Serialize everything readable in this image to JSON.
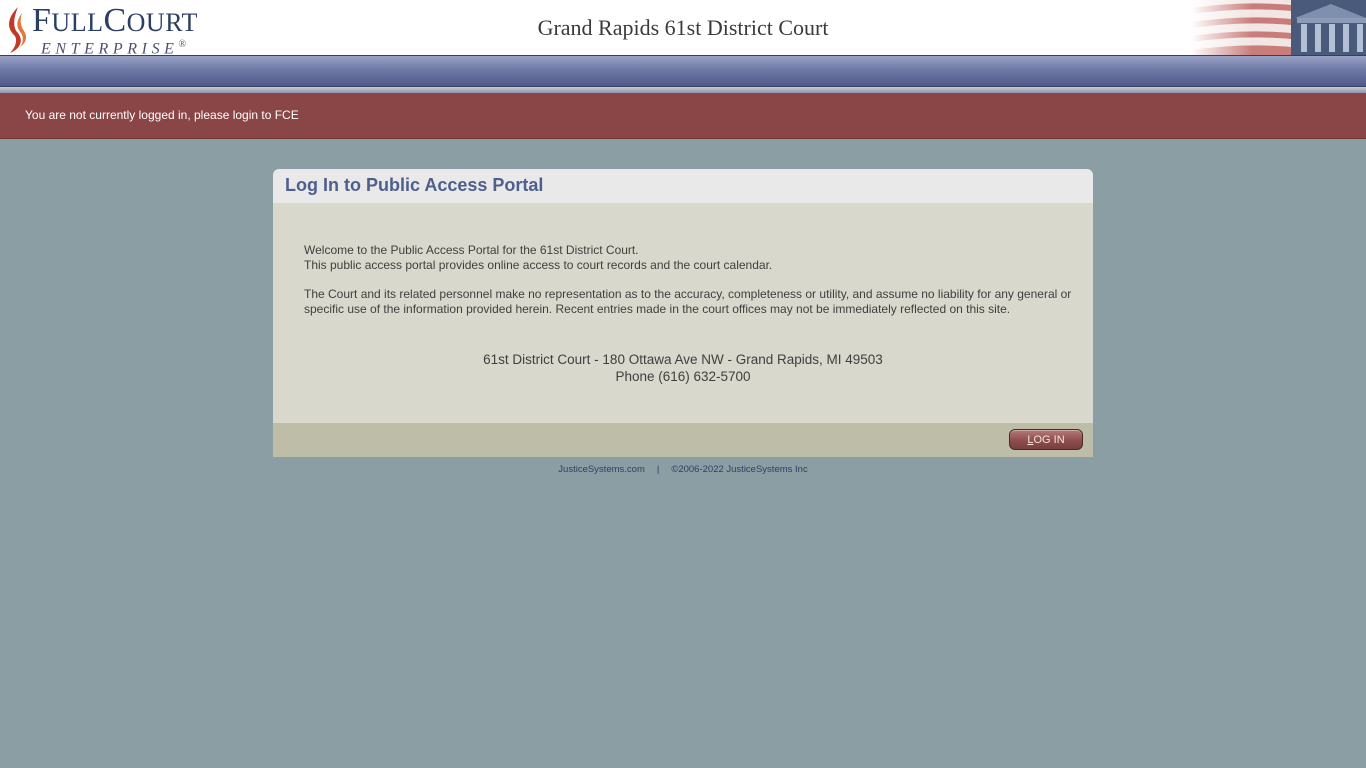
{
  "header": {
    "logo_full": "Full",
    "logo_court": "Court",
    "logo_enterprise": "ENTERPRISE",
    "logo_reg": "®",
    "court_title": "Grand Rapids 61st District Court"
  },
  "status": {
    "message": "You are not currently logged in, please login to FCE"
  },
  "panel": {
    "title": "Log In to Public Access Portal",
    "intro_line1": "Welcome to the Public Access Portal for the 61st District Court.",
    "intro_line2": "This public access portal provides online access to court records and the court calendar.",
    "disclaimer": "The Court and its related personnel make no representation as to the accuracy, completeness or utility, and assume no liability for any general or specific use of the information provided herein. Recent entries made in the court offices may not be immediately reflected on this site.",
    "address": "61st District Court - 180 Ottawa Ave NW - Grand Rapids, MI 49503",
    "phone": "Phone (616) 632-5700",
    "login_button_first": "L",
    "login_button_rest": "OG IN"
  },
  "footer": {
    "link": "JusticeSystems.com",
    "separator": "|",
    "copyright": "©2006-2022 JusticeSystems Inc"
  },
  "colors": {
    "status_bar": "#8a4546",
    "background": "#8a9ea3",
    "panel_title": "#4f5f8c",
    "button": "#8e4e50"
  }
}
